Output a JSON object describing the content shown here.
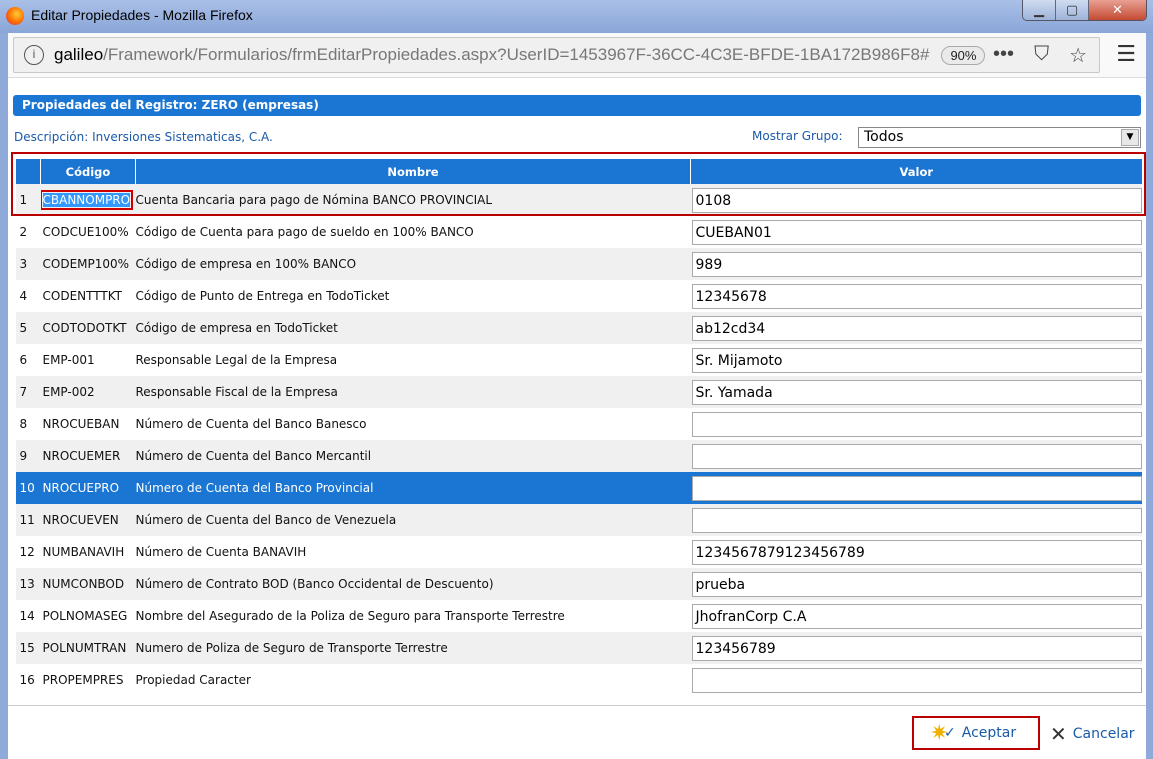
{
  "window": {
    "title": "Editar Propiedades - Mozilla Firefox"
  },
  "browser": {
    "url_host": "galileo",
    "url_path": "/Framework/Formularios/frmEditarPropiedades.aspx?UserID=1453967F-36CC-4C3E-BFDE-1BA172B986F8#",
    "zoom": "90%"
  },
  "page": {
    "header": "Propiedades del Registro: ZERO (empresas)",
    "description": "Descripción: Inversiones Sistematicas, C.A.",
    "group_label": "Mostrar Grupo:",
    "group_value": "Todos"
  },
  "table": {
    "headers": [
      "",
      "Código",
      "Nombre",
      "Valor"
    ],
    "rows": [
      {
        "n": "1",
        "code": "CBANNOMPRO",
        "name": "Cuenta Bancaria para pago de Nómina BANCO PROVINCIAL",
        "value": "0108"
      },
      {
        "n": "2",
        "code": "CODCUE100%",
        "name": "Código de Cuenta para pago de sueldo en 100% BANCO",
        "value": "CUEBAN01"
      },
      {
        "n": "3",
        "code": "CODEMP100%",
        "name": "Código de empresa en 100% BANCO",
        "value": "989"
      },
      {
        "n": "4",
        "code": "CODENTTTKT",
        "name": "Código de Punto de Entrega en TodoTicket",
        "value": "12345678"
      },
      {
        "n": "5",
        "code": "CODTODOTKT",
        "name": "Código de empresa en TodoTicket",
        "value": "ab12cd34"
      },
      {
        "n": "6",
        "code": "EMP-001",
        "name": "Responsable Legal de la Empresa",
        "value": "Sr. Mijamoto"
      },
      {
        "n": "7",
        "code": "EMP-002",
        "name": "Responsable Fiscal de la Empresa",
        "value": "Sr. Yamada"
      },
      {
        "n": "8",
        "code": "NROCUEBAN",
        "name": "Número de Cuenta del Banco Banesco",
        "value": ""
      },
      {
        "n": "9",
        "code": "NROCUEMER",
        "name": "Número de Cuenta del Banco Mercantil",
        "value": ""
      },
      {
        "n": "10",
        "code": "NROCUEPRO",
        "name": "Número de Cuenta del Banco Provincial",
        "value": ""
      },
      {
        "n": "11",
        "code": "NROCUEVEN",
        "name": "Número de Cuenta del Banco de Venezuela",
        "value": ""
      },
      {
        "n": "12",
        "code": "NUMBANAVIH",
        "name": "Número de Cuenta BANAVIH",
        "value": "1234567879123456789"
      },
      {
        "n": "13",
        "code": "NUMCONBOD",
        "name": "Número de Contrato BOD (Banco Occidental de Descuento)",
        "value": "prueba"
      },
      {
        "n": "14",
        "code": "POLNOMASEG",
        "name": "Nombre del Asegurado de la Poliza de Seguro para Transporte Terrestre",
        "value": "JhofranCorp C.A"
      },
      {
        "n": "15",
        "code": "POLNUMTRAN",
        "name": "Numero de Poliza de Seguro de Transporte Terrestre",
        "value": "123456789"
      },
      {
        "n": "16",
        "code": "PROPEMPRES",
        "name": "Propiedad Caracter",
        "value": ""
      }
    ]
  },
  "footer": {
    "accept": "Aceptar",
    "cancel": "Cancelar"
  }
}
